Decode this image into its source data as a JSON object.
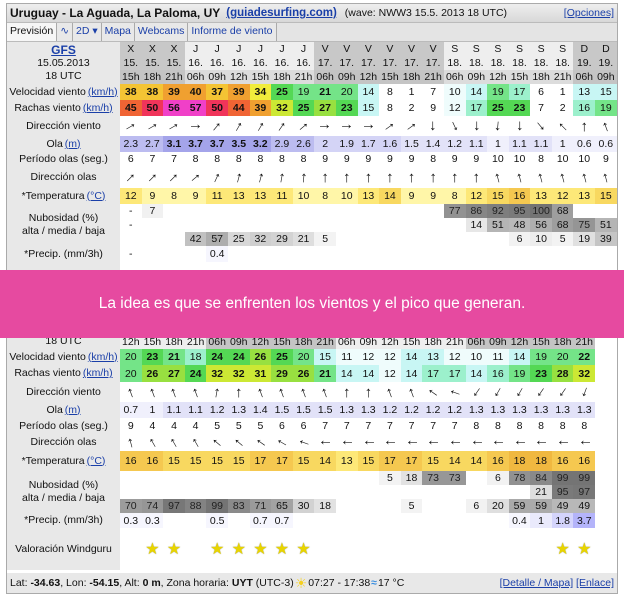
{
  "header": {
    "place": "Uruguay - La Aguada, La Paloma, UY",
    "site": "(guiadesurfing.com)",
    "wave": "(wave: NWW3 15.5. 2013 18 UTC)",
    "options": "[Opciones]"
  },
  "tabs": [
    {
      "label": "Previsión"
    },
    {
      "label": "∿"
    },
    {
      "label": "2D ▾"
    },
    {
      "label": "Mapa"
    },
    {
      "label": "Webcams"
    },
    {
      "label": "Informe de viento"
    }
  ],
  "model": {
    "name": "GFS",
    "date": "15.05.2013",
    "utc": "18 UTC"
  },
  "labels": {
    "speed": "Velocidad viento",
    "gust": "Rachas viento",
    "kmh": "(km/h)",
    "winddir": "Dirección viento",
    "ola": "Ola",
    "m": "(m)",
    "period": "Período olas (seg.)",
    "wavedir": "Dirección olas",
    "temp": "*Temperatura",
    "c": "(°C)",
    "nub": "Nubosidad (%)",
    "nub2": "alta / media / baja",
    "precip": "*Precip. (mm/3h)",
    "rating": "Valoración Windguru"
  },
  "top": {
    "days": [
      "X",
      "X",
      "X",
      "J",
      "J",
      "J",
      "J",
      "J",
      "J",
      "V",
      "V",
      "V",
      "V",
      "V",
      "V",
      "S",
      "S",
      "S",
      "S",
      "S",
      "S",
      "D",
      "D"
    ],
    "dates": [
      "15.",
      "15.",
      "15.",
      "16.",
      "16.",
      "16.",
      "16.",
      "16.",
      "16.",
      "17.",
      "17.",
      "17.",
      "17.",
      "17.",
      "17.",
      "18.",
      "18.",
      "18.",
      "18.",
      "18.",
      "18.",
      "19.",
      "19."
    ],
    "hours": [
      "15h",
      "18h",
      "21h",
      "06h",
      "09h",
      "12h",
      "15h",
      "18h",
      "21h",
      "06h",
      "09h",
      "12h",
      "15h",
      "18h",
      "21h",
      "06h",
      "09h",
      "12h",
      "15h",
      "18h",
      "21h",
      "06h",
      "09h"
    ],
    "speed": [
      38,
      38,
      39,
      40,
      37,
      39,
      34,
      25,
      19,
      21,
      20,
      14,
      8,
      1,
      7,
      10,
      14,
      19,
      17,
      6,
      1,
      13,
      15
    ],
    "gust": [
      45,
      50,
      56,
      57,
      50,
      44,
      39,
      32,
      25,
      27,
      23,
      15,
      8,
      2,
      9,
      12,
      17,
      25,
      23,
      7,
      2,
      16,
      19
    ],
    "winddir_deg": [
      60,
      60,
      60,
      90,
      40,
      30,
      30,
      35,
      50,
      90,
      90,
      90,
      55,
      55,
      180,
      155,
      180,
      185,
      180,
      140,
      315,
      0,
      340
    ],
    "ola": [
      2.3,
      2.7,
      3.1,
      3.7,
      3.7,
      3.5,
      3.2,
      2.9,
      2.6,
      2,
      1.9,
      1.7,
      1.6,
      1.5,
      1.4,
      1.2,
      1.1,
      1,
      1.1,
      1.1,
      1,
      0.6,
      0.6
    ],
    "period": [
      6,
      7,
      7,
      8,
      8,
      8,
      8,
      8,
      8,
      9,
      9,
      9,
      9,
      9,
      8,
      9,
      9,
      10,
      10,
      8,
      10,
      10,
      9
    ],
    "wavedir_deg": [
      45,
      45,
      45,
      50,
      25,
      15,
      15,
      10,
      5,
      0,
      0,
      0,
      0,
      0,
      0,
      0,
      0,
      345,
      345,
      345,
      345,
      345,
      345
    ],
    "temp": [
      12,
      9,
      8,
      9,
      11,
      13,
      13,
      11,
      10,
      8,
      10,
      13,
      14,
      9,
      9,
      8,
      12,
      15,
      16,
      13,
      12,
      13,
      15
    ],
    "nub_high": [
      "-",
      "7",
      "",
      "",
      "",
      "",
      "",
      "",
      "",
      "",
      "",
      "",
      "",
      "",
      "",
      "77",
      "86",
      "92",
      "95",
      "100",
      "68",
      "",
      ""
    ],
    "nub_mid": [
      "-",
      "",
      "",
      "",
      "",
      "",
      "",
      "",
      "",
      "",
      "",
      "",
      "",
      "",
      "",
      "",
      "14",
      "51",
      "48",
      "56",
      "68",
      "75",
      "51"
    ],
    "nub_low": [
      "",
      "",
      "",
      "42",
      "57",
      "25",
      "32",
      "29",
      "21",
      "5",
      "",
      "",
      "",
      "",
      "",
      "",
      "",
      "",
      "6",
      "10",
      "5",
      "19",
      "39"
    ],
    "precip": [
      "-",
      "",
      "",
      "",
      "0.4",
      "",
      "",
      "",
      "",
      "",
      "",
      "",
      "",
      "",
      "",
      "",
      "",
      "",
      "",
      "",
      "",
      "",
      ""
    ],
    "stars": [
      1,
      1,
      1,
      1,
      1,
      1,
      0,
      0,
      0,
      0,
      0,
      0,
      0,
      0,
      0,
      0,
      0,
      0,
      0,
      0,
      0,
      0,
      0
    ]
  },
  "bottom": {
    "hours": [
      "12h",
      "15h",
      "18h",
      "21h",
      "06h",
      "09h",
      "12h",
      "15h",
      "18h",
      "21h",
      "06h",
      "09h",
      "12h",
      "15h",
      "18h",
      "21h",
      "06h",
      "09h",
      "12h",
      "15h",
      "18h",
      "21h"
    ],
    "day_shade": [
      0,
      0,
      0,
      0,
      1,
      1,
      1,
      1,
      1,
      1,
      0,
      0,
      0,
      0,
      0,
      0,
      1,
      1,
      1,
      1,
      1,
      1
    ],
    "speed": [
      20,
      23,
      21,
      18,
      24,
      24,
      26,
      25,
      20,
      15,
      11,
      12,
      12,
      14,
      13,
      12,
      10,
      11,
      14,
      19,
      20,
      22
    ],
    "gust": [
      20,
      26,
      27,
      24,
      32,
      32,
      31,
      29,
      26,
      21,
      14,
      14,
      12,
      14,
      17,
      17,
      14,
      16,
      19,
      23,
      28,
      32
    ],
    "winddir_deg": [
      340,
      340,
      340,
      340,
      10,
      0,
      340,
      340,
      340,
      340,
      0,
      0,
      340,
      340,
      305,
      290,
      215,
      210,
      210,
      215,
      215,
      200
    ],
    "ola": [
      0.7,
      1,
      1.1,
      1.1,
      1.2,
      1.3,
      1.4,
      1.5,
      1.5,
      1.5,
      1.3,
      1.3,
      1.2,
      1.2,
      1.2,
      1.2,
      1.3,
      1.3,
      1.3,
      1.3,
      1.3,
      1.3
    ],
    "period": [
      9,
      4,
      4,
      4,
      5,
      5,
      5,
      6,
      6,
      7,
      7,
      7,
      7,
      7,
      7,
      7,
      8,
      8,
      8,
      8,
      8,
      8
    ],
    "wavedir_deg": [
      345,
      330,
      330,
      330,
      310,
      310,
      305,
      300,
      290,
      270,
      270,
      270,
      270,
      270,
      270,
      270,
      270,
      270,
      270,
      270,
      270,
      270
    ],
    "temp": [
      16,
      16,
      15,
      15,
      15,
      15,
      17,
      17,
      15,
      14,
      13,
      15,
      17,
      17,
      15,
      14,
      14,
      16,
      18,
      18,
      16,
      16
    ],
    "nub_high": [
      "",
      "",
      "",
      "",
      "",
      "",
      "",
      "",
      "",
      "",
      "",
      "",
      "5",
      "18",
      "73",
      "73",
      "",
      "6",
      "78",
      "84",
      "99",
      "99"
    ],
    "nub_mid": [
      "",
      "",
      "",
      "",
      "",
      "",
      "",
      "",
      "",
      "",
      "",
      "",
      "",
      "",
      "",
      "",
      "",
      "",
      "",
      "21",
      "95",
      "97"
    ],
    "nub_low": [
      "70",
      "74",
      "97",
      "88",
      "99",
      "83",
      "71",
      "65",
      "30",
      "18",
      "",
      "",
      "",
      "5",
      "",
      "",
      "6",
      "20",
      "59",
      "59",
      "49",
      "49"
    ],
    "precip": [
      "0.3",
      "0.3",
      "",
      "",
      "0.5",
      "",
      "0.7",
      "0.7",
      "",
      "",
      "",
      "",
      "",
      "",
      "",
      "",
      "",
      "",
      "0.4",
      "1",
      "1.8",
      "3.7"
    ],
    "stars": [
      0,
      1,
      1,
      0,
      1,
      1,
      1,
      1,
      1,
      0,
      0,
      0,
      0,
      0,
      0,
      0,
      0,
      0,
      0,
      0,
      1,
      1
    ]
  },
  "banner": "La idea es que se enfrenten los vientos y el pico que generan.",
  "footer": {
    "lat_label": "Lat:",
    "lat": "-34.63",
    "lon_label": ", Lon:",
    "lon": "-54.15",
    "alt_label": ", Alt:",
    "alt": "0 m",
    "tz_label": ", Zona horaria:",
    "tz": "UYT",
    "utc": "(UTC-3)",
    "sun": "07:27 - 17:38",
    "water": "17 °C",
    "detail": "[Detalle / Mapa]",
    "link": "[Enlace]"
  }
}
